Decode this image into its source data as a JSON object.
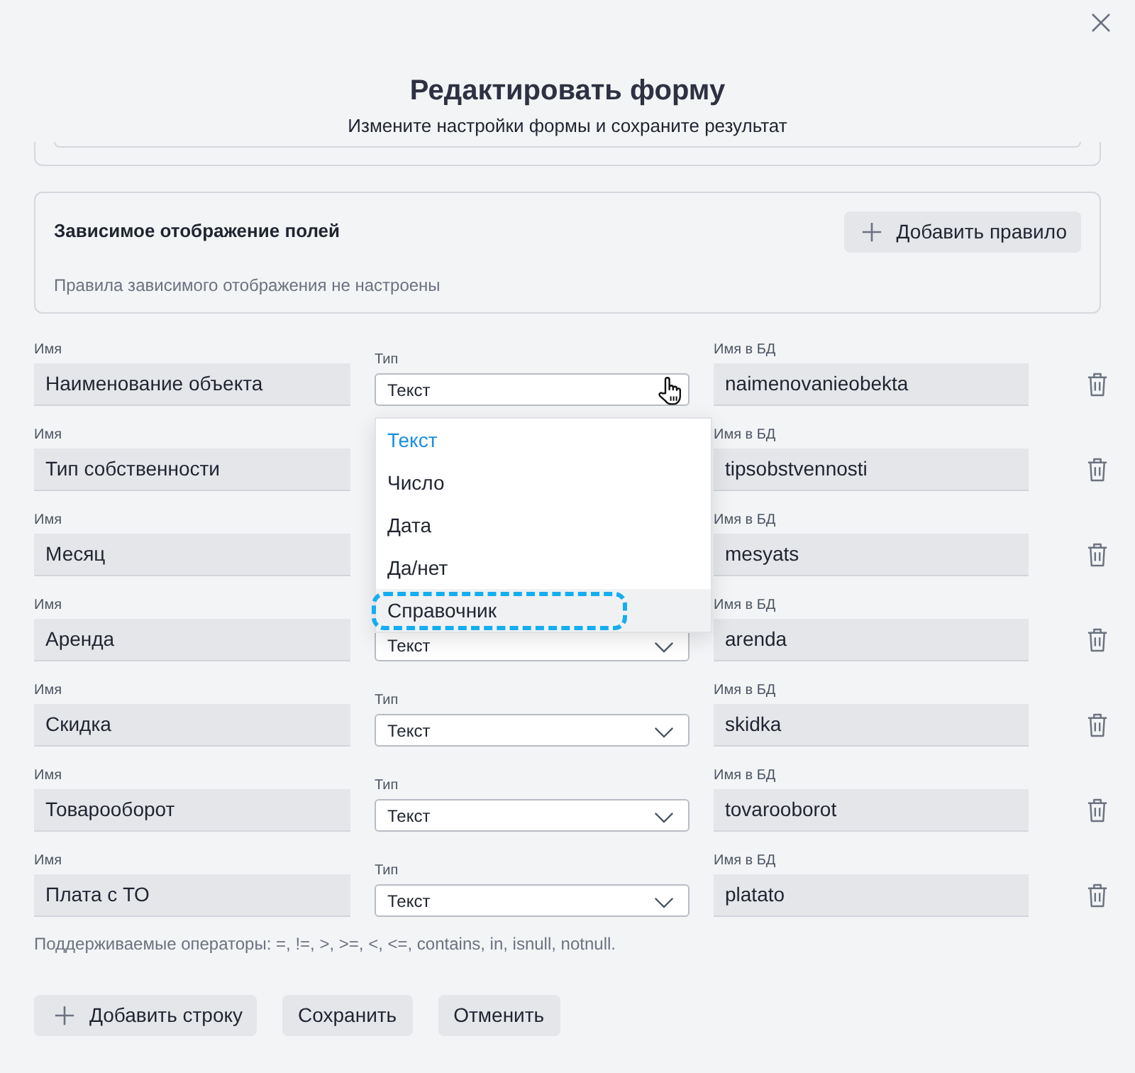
{
  "dialog": {
    "title": "Редактировать форму",
    "subtitle": "Измените настройки формы и сохраните результат"
  },
  "dependent_display": {
    "title": "Зависимое отображение полей",
    "add_button": "Добавить правило",
    "empty_text": "Правила зависимого отображения не настроены"
  },
  "fields": [
    {
      "name_label": "Имя",
      "name": "Наименование объекта",
      "type_label": "Тип",
      "type": "Текст",
      "expanded": true,
      "db_label": "Имя в БД",
      "db_name": "naimenovanieobekta"
    },
    {
      "name_label": "Имя",
      "name": "Тип собственности",
      "expanded": false,
      "db_label": "Имя в БД",
      "db_name": "tipsobstvennosti"
    },
    {
      "name_label": "Имя",
      "name": "Месяц",
      "expanded": false,
      "db_label": "Имя в БД",
      "db_name": "mesyats"
    },
    {
      "name_label": "Имя",
      "name": "Аренда",
      "type": "Текст",
      "expanded": false,
      "db_label": "Имя в БД",
      "db_name": "arenda"
    },
    {
      "name_label": "Имя",
      "name": "Скидка",
      "type_label": "Тип",
      "type": "Текст",
      "expanded": false,
      "db_label": "Имя в БД",
      "db_name": "skidka"
    },
    {
      "name_label": "Имя",
      "name": "Товарооборот",
      "type_label": "Тип",
      "type": "Текст",
      "expanded": false,
      "db_label": "Имя в БД",
      "db_name": "tovarooborot"
    },
    {
      "name_label": "Имя",
      "name": "Плата с ТО",
      "type_label": "Тип",
      "type": "Текст",
      "expanded": false,
      "db_label": "Имя в БД",
      "db_name": "platato"
    }
  ],
  "type_dropdown": {
    "options": [
      {
        "label": "Текст",
        "selected": true,
        "hovered": false,
        "outlined": false
      },
      {
        "label": "Число",
        "selected": false,
        "hovered": false,
        "outlined": false
      },
      {
        "label": "Дата",
        "selected": false,
        "hovered": false,
        "outlined": false
      },
      {
        "label": "Да/нет",
        "selected": false,
        "hovered": false,
        "outlined": false
      },
      {
        "label": "Справочник",
        "selected": false,
        "hovered": true,
        "outlined": true
      }
    ]
  },
  "operators_note": "Поддерживаемые операторы: =, !=, >, >=, <, <=, contains, in, isnull, notnull.",
  "actions": [
    {
      "kind": "add",
      "label": "Добавить строку"
    },
    {
      "kind": "plain",
      "label": "Сохранить"
    },
    {
      "kind": "plain",
      "label": "Отменить"
    }
  ]
}
